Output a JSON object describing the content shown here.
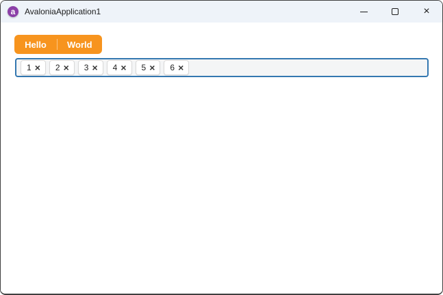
{
  "colors": {
    "accent_orange": "#F7941E",
    "focus_border_blue": "#3377B0",
    "titlebar_bg": "#EEF3F9",
    "window_border": "#3F3F3F",
    "logo_purple": "#8B3FA8"
  },
  "titlebar": {
    "title": "AvaloniaApplication1",
    "logo_letter": "a"
  },
  "icons": {
    "minimize": "horizontal-line-shape",
    "maximize": "square-outline-shape",
    "close": "×",
    "remove_tag": "×",
    "app_logo": "avalonia-a"
  },
  "tabstrip": {
    "buttons": [
      {
        "label": "Hello"
      },
      {
        "label": "World"
      }
    ]
  },
  "tagbox": {
    "remove_glyph": "×",
    "tags": [
      {
        "value": "1"
      },
      {
        "value": "2"
      },
      {
        "value": "3"
      },
      {
        "value": "4"
      },
      {
        "value": "5"
      },
      {
        "value": "6"
      }
    ]
  }
}
